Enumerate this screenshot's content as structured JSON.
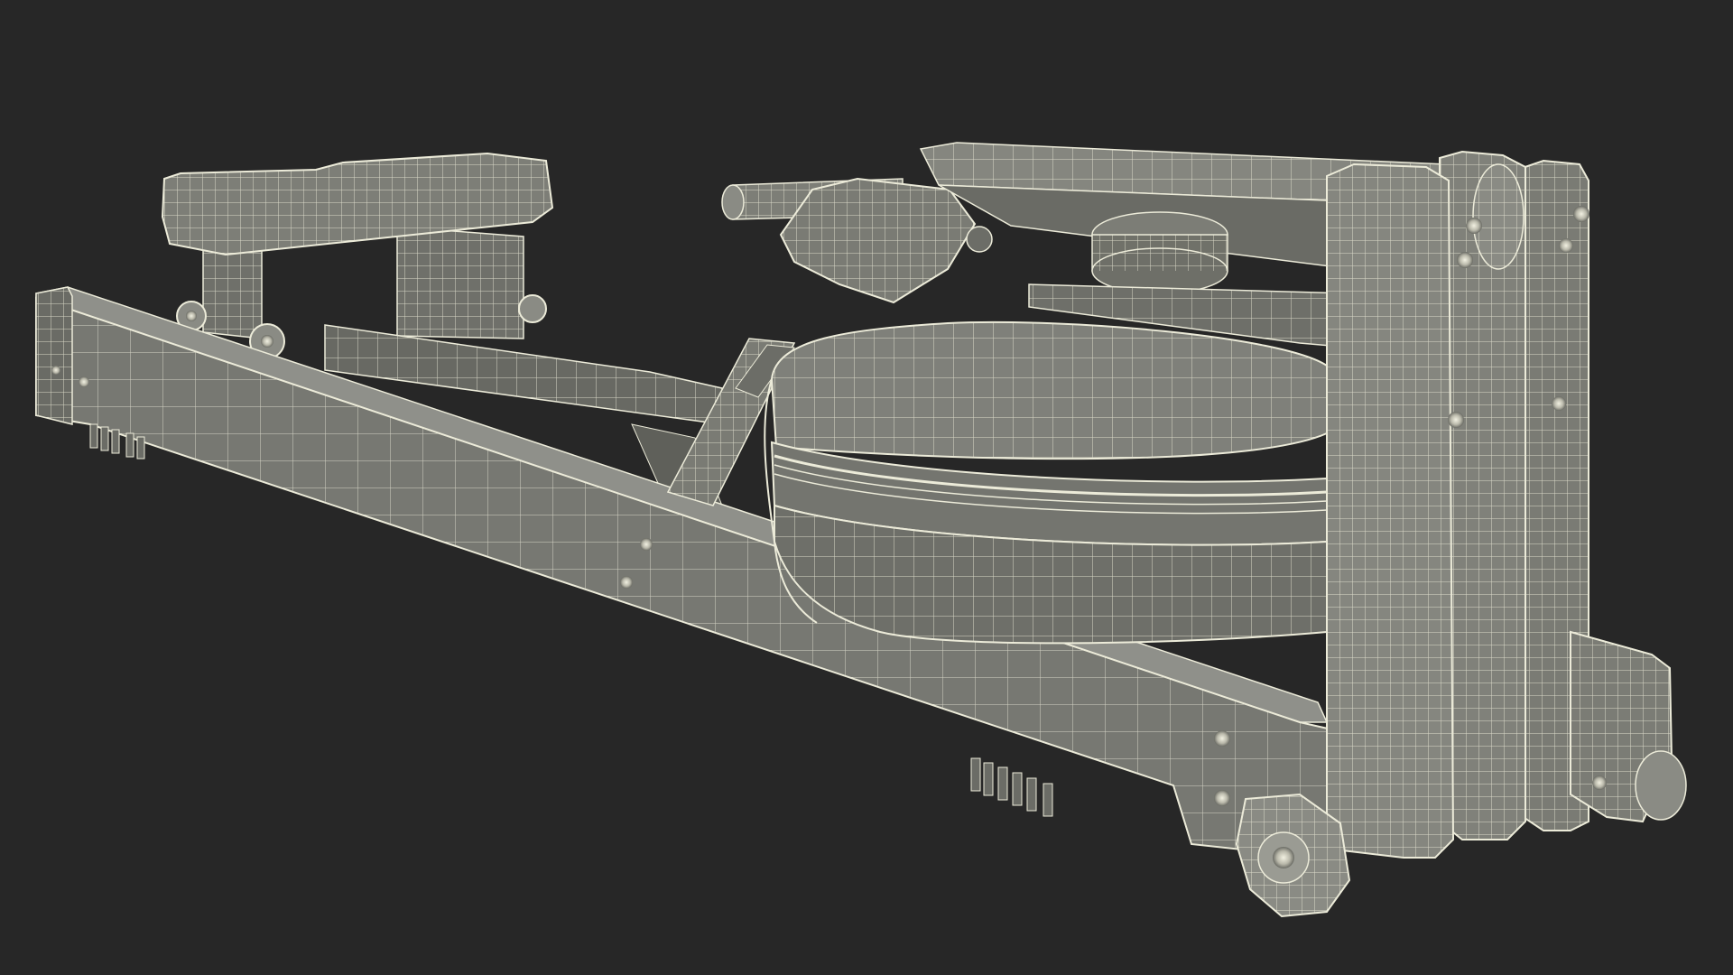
{
  "scene": {
    "subject": "rowing-machine-wireframe",
    "colors": {
      "background": "#272727",
      "surface": "#75766f",
      "surface_light": "#8a8b84",
      "surface_dark": "#5c5d57",
      "wire": "#ecebd9",
      "wire_faint": "#cfcebf"
    }
  }
}
